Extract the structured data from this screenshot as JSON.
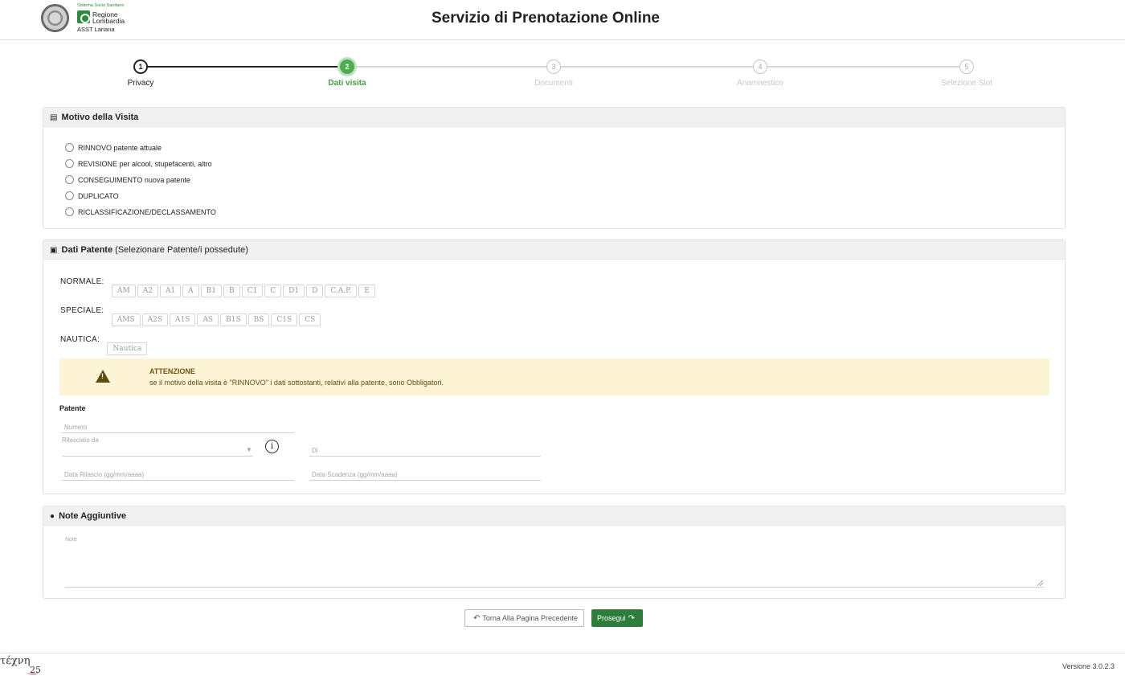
{
  "header": {
    "title": "Servizio di Prenotazione Online",
    "logo_system": "Sistema Socio Sanitario",
    "logo_region": "Regione\nLombardia",
    "logo_asst": "ASST Lariana"
  },
  "stepper": {
    "steps": [
      {
        "number": "1",
        "label": "Privacy",
        "state": "done"
      },
      {
        "number": "2",
        "label": "Dati visita",
        "state": "active"
      },
      {
        "number": "3",
        "label": "Documenti",
        "state": "pending"
      },
      {
        "number": "4",
        "label": "Anamnestico",
        "state": "pending"
      },
      {
        "number": "5",
        "label": "Selezione Slot",
        "state": "pending"
      }
    ]
  },
  "motivo": {
    "title": "Motivo della Visita",
    "icon": "clipboard-icon",
    "options": [
      {
        "label": "RINNOVO patente attuale",
        "checked": false
      },
      {
        "label": "REVISIONE per alcool, stupefacenti, altro",
        "checked": false
      },
      {
        "label": "CONSEGUIMENTO nuova patente",
        "checked": false
      },
      {
        "label": "DUPLICATO",
        "checked": false
      },
      {
        "label": "RICLASSIFICAZIONE/DECLASSAMENTO",
        "checked": false
      }
    ]
  },
  "patente": {
    "title": "Dati Patente",
    "subtitle": "(Selezionare Patente/i possedute)",
    "icon": "id-card-icon",
    "normale_label": "NORMALE:",
    "normale": [
      "AM",
      "A2",
      "A1",
      "A",
      "B1",
      "B",
      "C1",
      "C",
      "D1",
      "D",
      "C.A.P.",
      "E"
    ],
    "speciale_label": "SPECIALE:",
    "speciale": [
      "AMS",
      "A2S",
      "A1S",
      "AS",
      "B1S",
      "BS",
      "C1S",
      "CS"
    ],
    "nautica_label": "NAUTICA:",
    "nautica": [
      "Nautica"
    ],
    "alert_title": "ATTENZIONE",
    "alert_text": "se il motivo della visita è \"RINNOVO\" i dati sottostanti, relativi alla patente, sono Obbligatori.",
    "section_label": "Patente",
    "numero_placeholder": "Numero",
    "rilasciato_placeholder": "Rilasciato da",
    "di_placeholder": "Di",
    "data_rilascio_placeholder": "Data Rilascio (gg/mm/aaaa)",
    "data_scadenza_placeholder": "Data Scadenza (gg/mm/aaaa)",
    "info_icon": "i"
  },
  "note": {
    "title": "Note Aggiuntive",
    "icon": "comment-icon",
    "placeholder": "Note"
  },
  "buttons": {
    "back": "Torna Alla Pagina Precedente",
    "next": "Prosegui"
  },
  "footer": {
    "logo": "τέχνη",
    "logo_sub": "25",
    "version": "Versione 3.0.2.3"
  },
  "colors": {
    "accent": "#2f7d3d",
    "active_step": "#4cae4c",
    "alert_bg": "#fdf4d5"
  }
}
